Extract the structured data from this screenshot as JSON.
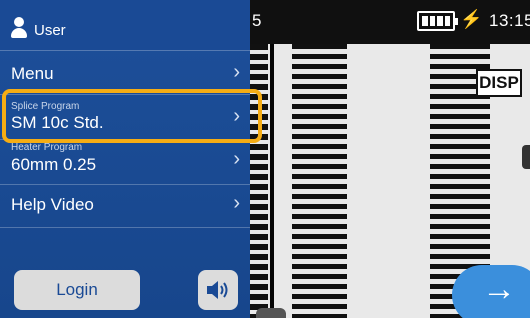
{
  "status": {
    "left_text": "5",
    "charging_symbol": "⚡",
    "time": "13:15"
  },
  "view": {
    "disp_label": "DISP",
    "next_arrow": "→"
  },
  "panel": {
    "user_label": "User",
    "items": [
      {
        "label": "Menu",
        "sub": ""
      },
      {
        "label": "SM 10c Std.",
        "sub": "Splice Program"
      },
      {
        "label": "60mm 0.25",
        "sub": "Heater Program"
      },
      {
        "label": "Help Video",
        "sub": ""
      }
    ],
    "chevron": "›",
    "login_label": "Login"
  },
  "colors": {
    "panel": "#1d4f9a",
    "highlight": "#f6ad14",
    "next_button": "#3b8fdc"
  }
}
